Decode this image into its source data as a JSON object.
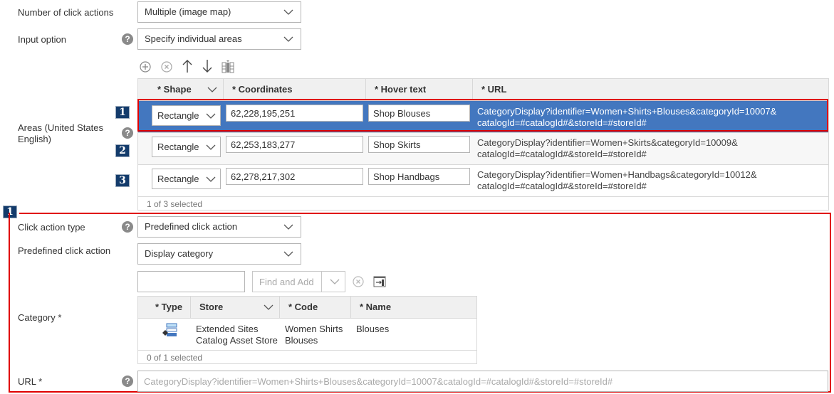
{
  "form": {
    "click_actions": {
      "label": "Number of click actions",
      "value": "Multiple (image map)"
    },
    "input_option": {
      "label": "Input option",
      "value": "Specify individual areas"
    },
    "areas": {
      "label": "Areas (United States English)",
      "toolbar": {
        "add": "add-icon",
        "remove": "remove-icon",
        "move_up": "arrow-up-icon",
        "move_down": "arrow-down-icon",
        "columns": "columns-icon"
      },
      "columns": [
        "* Shape",
        "* Coordinates",
        "* Hover text",
        "* URL"
      ],
      "rows": [
        {
          "badge": "1",
          "shape": "Rectangle",
          "coordinates": "62,228,195,251",
          "hover": "Shop Blouses",
          "url_line1": "CategoryDisplay?identifier=Women+Shirts+Blouses&categoryId=10007&",
          "url_line2": "catalogId=#catalogId#&storeId=#storeId#",
          "selected": true
        },
        {
          "badge": "2",
          "shape": "Rectangle",
          "coordinates": "62,253,183,277",
          "hover": "Shop Skirts",
          "url_line1": "CategoryDisplay?identifier=Women+Skirts&categoryId=10009&",
          "url_line2": "catalogId=#catalogId#&storeId=#storeId#",
          "selected": false
        },
        {
          "badge": "3",
          "shape": "Rectangle",
          "coordinates": "62,278,217,302",
          "hover": "Shop Handbags",
          "url_line1": "CategoryDisplay?identifier=Women+Handbags&categoryId=10012&",
          "url_line2": "catalogId=#catalogId#&storeId=#storeId#",
          "selected": false
        }
      ],
      "footer": "1 of 3 selected"
    },
    "detail_badge": "1",
    "click_action_type": {
      "label": "Click action type",
      "value": "Predefined click action"
    },
    "predefined_click_action": {
      "label": "Predefined click action",
      "value": "Display category"
    },
    "category": {
      "label": "Category *",
      "search_value": "",
      "find_add_placeholder": "Find and Add",
      "columns": [
        "* Type",
        "Store",
        "* Code",
        "* Name"
      ],
      "rows": [
        {
          "type_icon": "category-icon",
          "store_line1": "Extended Sites",
          "store_line2": "Catalog Asset Store",
          "code_line1": "Women Shirts",
          "code_line2": "Blouses",
          "name": "Blouses"
        }
      ],
      "footer": "0 of 1 selected"
    },
    "url": {
      "label": "URL *",
      "value": "CategoryDisplay?identifier=Women+Shirts+Blouses&categoryId=10007&catalogId=#catalogId#&storeId=#storeId#"
    }
  },
  "colors": {
    "selected_row": "#4377bf",
    "highlight_border": "#e00000",
    "badge": "#133b6b"
  }
}
